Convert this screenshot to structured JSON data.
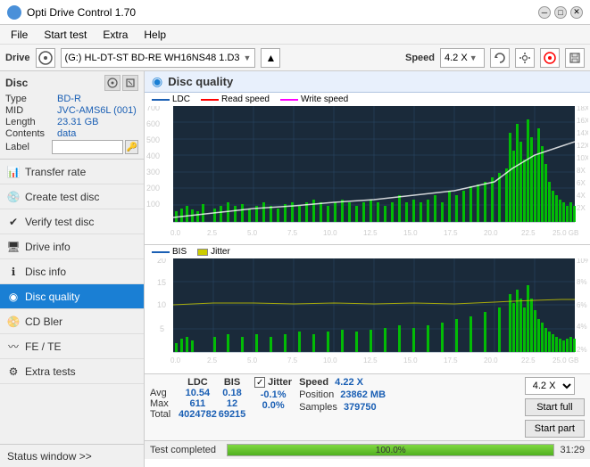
{
  "titleBar": {
    "title": "Opti Drive Control 1.70",
    "controls": [
      "─",
      "□",
      "✕"
    ]
  },
  "menuBar": {
    "items": [
      "File",
      "Start test",
      "Extra",
      "Help"
    ]
  },
  "driveBar": {
    "label": "Drive",
    "driveValue": "(G:) HL-DT-ST BD-RE  WH16NS48 1.D3",
    "speedLabel": "Speed",
    "speedValue": "4.2 X"
  },
  "disc": {
    "title": "Disc",
    "type_label": "Type",
    "type_value": "BD-R",
    "mid_label": "MID",
    "mid_value": "JVC-AMS6L (001)",
    "length_label": "Length",
    "length_value": "23.31 GB",
    "contents_label": "Contents",
    "contents_value": "data",
    "label_label": "Label",
    "label_value": ""
  },
  "sidebar": {
    "items": [
      {
        "id": "transfer-rate",
        "label": "Transfer rate",
        "active": false
      },
      {
        "id": "create-test-disc",
        "label": "Create test disc",
        "active": false
      },
      {
        "id": "verify-test-disc",
        "label": "Verify test disc",
        "active": false
      },
      {
        "id": "drive-info",
        "label": "Drive info",
        "active": false
      },
      {
        "id": "disc-info",
        "label": "Disc info",
        "active": false
      },
      {
        "id": "disc-quality",
        "label": "Disc quality",
        "active": true
      },
      {
        "id": "cd-bler",
        "label": "CD Bler",
        "active": false
      },
      {
        "id": "fe-te",
        "label": "FE / TE",
        "active": false
      },
      {
        "id": "extra-tests",
        "label": "Extra tests",
        "active": false
      }
    ],
    "statusWindow": "Status window >>"
  },
  "content": {
    "title": "Disc quality",
    "chart1": {
      "legend": [
        {
          "id": "ldc",
          "label": "LDC"
        },
        {
          "id": "read",
          "label": "Read speed"
        },
        {
          "id": "write",
          "label": "Write speed"
        }
      ],
      "yAxisLeft": [
        "700",
        "600",
        "500",
        "400",
        "300",
        "200",
        "100"
      ],
      "yAxisRight": [
        "18X",
        "16X",
        "14X",
        "12X",
        "10X",
        "8X",
        "6X",
        "4X",
        "2X"
      ],
      "xAxis": [
        "0.0",
        "2.5",
        "5.0",
        "7.5",
        "10.0",
        "12.5",
        "15.0",
        "17.5",
        "20.0",
        "22.5",
        "25.0 GB"
      ]
    },
    "chart2": {
      "legend": [
        {
          "id": "bis",
          "label": "BIS"
        },
        {
          "id": "jitter",
          "label": "Jitter"
        }
      ],
      "yAxisLeft": [
        "20",
        "15",
        "10",
        "5"
      ],
      "yAxisRight": [
        "10%",
        "8%",
        "6%",
        "4%",
        "2%"
      ],
      "xAxis": [
        "0.0",
        "2.5",
        "5.0",
        "7.5",
        "10.0",
        "12.5",
        "15.0",
        "17.5",
        "20.0",
        "22.5",
        "25.0 GB"
      ]
    },
    "stats": {
      "headers": [
        "LDC",
        "BIS",
        "",
        "Jitter",
        "Speed",
        ""
      ],
      "rows": [
        {
          "label": "Avg",
          "ldc": "10.54",
          "bis": "0.18",
          "jitter": "-0.1%"
        },
        {
          "label": "Max",
          "ldc": "611",
          "bis": "12",
          "jitter": "0.0%"
        },
        {
          "label": "Total",
          "ldc": "4024782",
          "bis": "69215",
          "jitter": ""
        }
      ],
      "jitter_checked": true,
      "speed_label": "Speed",
      "speed_value": "4.22 X",
      "position_label": "Position",
      "position_value": "23862 MB",
      "samples_label": "Samples",
      "samples_value": "379750",
      "speed_dropdown": "4.2 X",
      "btn_start_full": "Start full",
      "btn_start_part": "Start part"
    },
    "progressBar": {
      "value": 100,
      "text": "100.0%",
      "status": "Test completed",
      "time": "31:29"
    }
  }
}
